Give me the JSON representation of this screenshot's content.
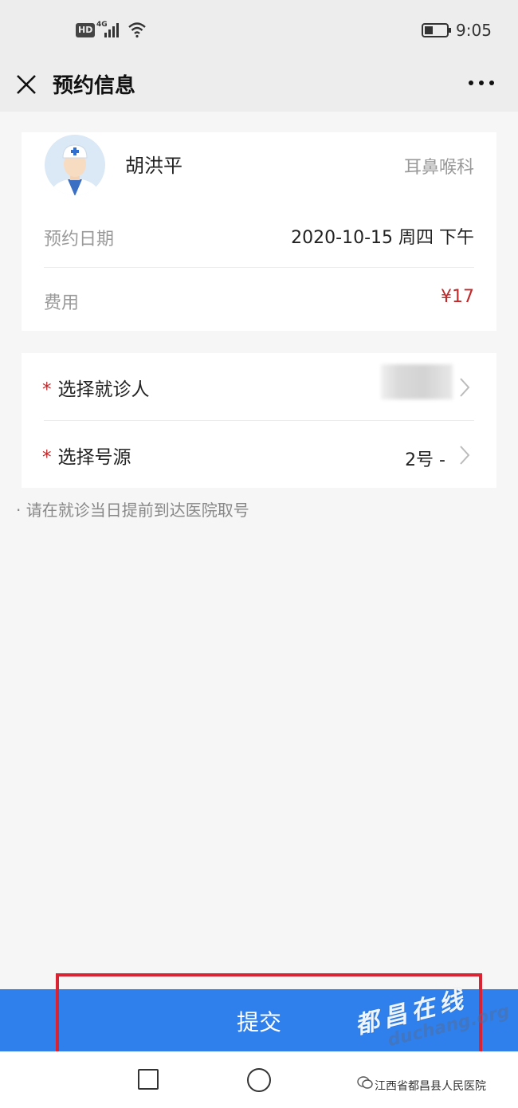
{
  "status_bar": {
    "hd_badge": "HD",
    "network_type": "4G",
    "time": "9:05"
  },
  "nav": {
    "title": "预约信息",
    "close_icon": "close-icon",
    "more_icon": "more-dots-icon"
  },
  "doctor": {
    "name": "胡洪平",
    "department": "耳鼻喉科",
    "avatar_icon": "doctor-avatar"
  },
  "appointment": {
    "date_label": "预约日期",
    "date_value": "2020-10-15 周四  下午",
    "fee_label": "费用",
    "fee_value": "¥17"
  },
  "selection": {
    "required_mark": "*",
    "patient_label": "选择就诊人",
    "source_label": "选择号源",
    "source_value": "2号 -"
  },
  "notice": "· 请在就诊当日提前到达医院取号",
  "submit_label": "提交",
  "watermark": {
    "text": "都昌在线",
    "url": "duchang.org",
    "footer": "江西省都昌县人民医院"
  },
  "colors": {
    "accent": "#2f80ed",
    "price": "#c0282a",
    "highlight": "#d92332"
  }
}
